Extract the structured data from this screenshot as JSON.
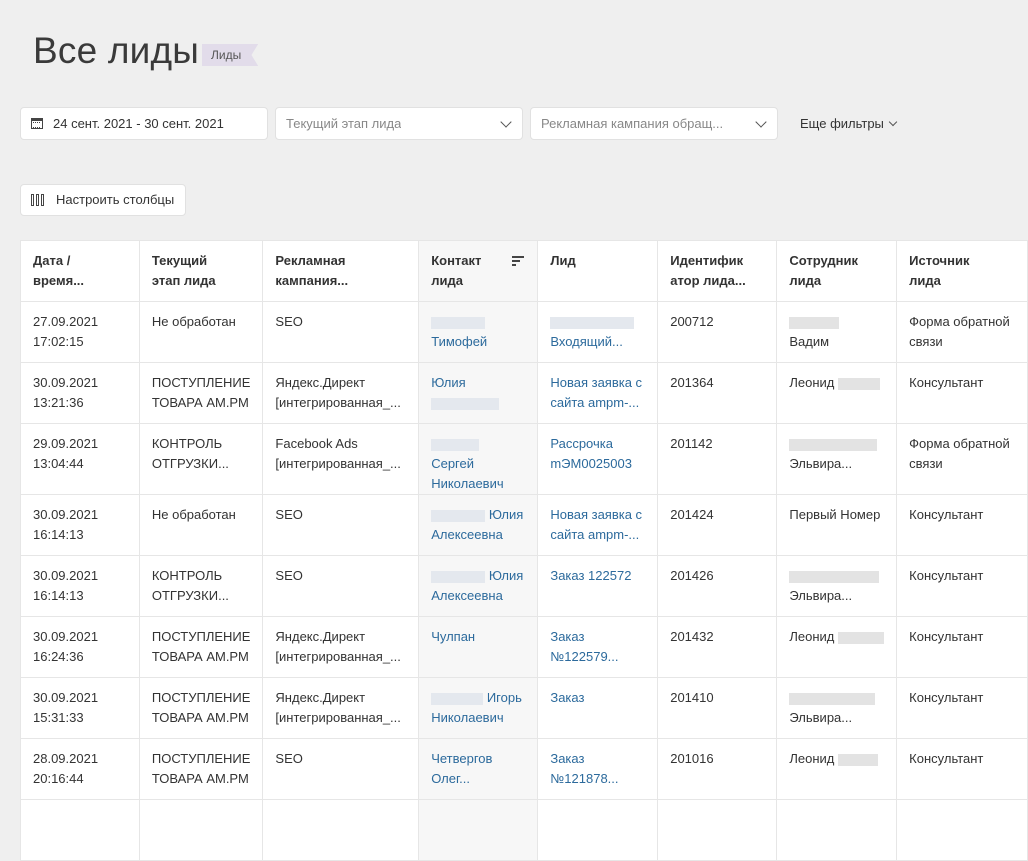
{
  "header": {
    "title": "Все лиды",
    "badge": "Лиды"
  },
  "filters": {
    "date_range": "24 сент. 2021 - 30 сент. 2021",
    "stage_placeholder": "Текущий этап лида",
    "campaign_placeholder": "Рекламная кампания обращ...",
    "more_label": "Еще фильтры"
  },
  "configure_columns_label": "Настроить столбцы",
  "table": {
    "headers": [
      [
        "Дата /",
        "время..."
      ],
      [
        "Текущий",
        "этап лида"
      ],
      [
        "Рекламная",
        "кампания..."
      ],
      [
        "Контакт",
        "лида"
      ],
      [
        "Лид",
        ""
      ],
      [
        "Идентифик",
        "атор лида..."
      ],
      [
        "Сотрудник",
        "лида"
      ],
      [
        "Источник",
        "лида"
      ]
    ],
    "rows": [
      {
        "date": [
          "27.09.2021",
          "17:02:15"
        ],
        "stage": [
          "Не обработан",
          ""
        ],
        "campaign": [
          "SEO",
          ""
        ],
        "contact": [
          "",
          "Тимофей"
        ],
        "lead": [
          "",
          "Входящий..."
        ],
        "id": "200712",
        "employee": [
          "",
          "Вадим"
        ],
        "source": [
          "Форма обратной",
          "связи"
        ]
      },
      {
        "date": [
          "30.09.2021",
          "13:21:36"
        ],
        "stage": [
          "ПОСТУПЛЕНИЕ",
          "ТОВАРА АМ.РМ"
        ],
        "campaign": [
          "Яндекс.Директ",
          "[интегрированная_..."
        ],
        "contact": [
          "Юлия",
          ""
        ],
        "lead": [
          "Новая заявка с",
          "сайта ampm-..."
        ],
        "id": "201364",
        "employee": [
          "Леонид",
          ""
        ],
        "source": [
          "Консультант",
          ""
        ]
      },
      {
        "date": [
          "29.09.2021",
          "13:04:44"
        ],
        "stage": [
          "КОНТРОЛЬ",
          "ОТГРУЗКИ..."
        ],
        "campaign": [
          "Facebook Ads",
          "[интегрированная_..."
        ],
        "contact": [
          "Сергей",
          "Николаевич"
        ],
        "lead": [
          "Рассрочка",
          "mЭМ0025003"
        ],
        "id": "201142",
        "employee": [
          "",
          "Эльвира..."
        ],
        "source": [
          "Форма обратной",
          "связи"
        ]
      },
      {
        "date": [
          "30.09.2021",
          "16:14:13"
        ],
        "stage": [
          "Не обработан",
          ""
        ],
        "campaign": [
          "SEO",
          ""
        ],
        "contact": [
          "Юлия",
          "Алексеевна"
        ],
        "lead": [
          "Новая заявка с",
          "сайта ampm-..."
        ],
        "id": "201424",
        "employee": [
          "Первый Номер",
          ""
        ],
        "source": [
          "Консультант",
          ""
        ]
      },
      {
        "date": [
          "30.09.2021",
          "16:14:13"
        ],
        "stage": [
          "КОНТРОЛЬ",
          "ОТГРУЗКИ..."
        ],
        "campaign": [
          "SEO",
          ""
        ],
        "contact": [
          "Юлия",
          "Алексеевна"
        ],
        "lead": [
          "Заказ 122572",
          ""
        ],
        "id": "201426",
        "employee": [
          "",
          "Эльвира..."
        ],
        "source": [
          "Консультант",
          ""
        ]
      },
      {
        "date": [
          "30.09.2021",
          "16:24:36"
        ],
        "stage": [
          "ПОСТУПЛЕНИЕ",
          "ТОВАРА АМ.РМ"
        ],
        "campaign": [
          "Яндекс.Директ",
          "[интегрированная_..."
        ],
        "contact": [
          "Чулпан",
          ""
        ],
        "lead": [
          "Заказ",
          "№122579..."
        ],
        "id": "201432",
        "employee": [
          "Леонид",
          ""
        ],
        "source": [
          "Консультант",
          ""
        ]
      },
      {
        "date": [
          "30.09.2021",
          "15:31:33"
        ],
        "stage": [
          "ПОСТУПЛЕНИЕ",
          "ТОВАРА АМ.РМ"
        ],
        "campaign": [
          "Яндекс.Директ",
          "[интегрированная_..."
        ],
        "contact": [
          "Игорь",
          "Николаевич"
        ],
        "lead": [
          "Заказ",
          ""
        ],
        "id": "201410",
        "employee": [
          "",
          "Эльвира..."
        ],
        "source": [
          "Консультант",
          ""
        ]
      },
      {
        "date": [
          "28.09.2021",
          "20:16:44"
        ],
        "stage": [
          "ПОСТУПЛЕНИЕ",
          "ТОВАРА АМ.РМ"
        ],
        "campaign": [
          "SEO",
          ""
        ],
        "contact": [
          "Четвергов",
          "Олег..."
        ],
        "lead": [
          "Заказ",
          "№121878..."
        ],
        "id": "201016",
        "employee": [
          "Леонид",
          ""
        ],
        "source": [
          "Консультант",
          ""
        ]
      }
    ]
  }
}
